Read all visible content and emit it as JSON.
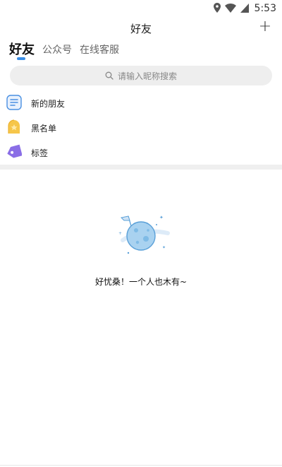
{
  "status_bar": {
    "time": "5:53",
    "icons": [
      "location-icon",
      "wifi-icon",
      "signal-icon"
    ]
  },
  "header": {
    "title": "好友",
    "add_label": "+"
  },
  "tabs": [
    {
      "label": "好友",
      "active": true
    },
    {
      "label": "公众号",
      "active": false
    },
    {
      "label": "在线客服",
      "active": false
    }
  ],
  "search": {
    "placeholder": "请输入昵称搜索",
    "icon": "search-icon"
  },
  "menu": [
    {
      "label": "新的朋友",
      "icon": "new-friends-icon"
    },
    {
      "label": "黑名单",
      "icon": "blacklist-icon"
    },
    {
      "label": "标签",
      "icon": "tag-icon"
    }
  ],
  "empty_state": {
    "message": "好忧桑！一个人也木有~",
    "icon": "planet-flag-icon"
  },
  "colors": {
    "accent": "#3a8ee6",
    "search_bg": "#eeeeee",
    "divider": "#efefef"
  }
}
